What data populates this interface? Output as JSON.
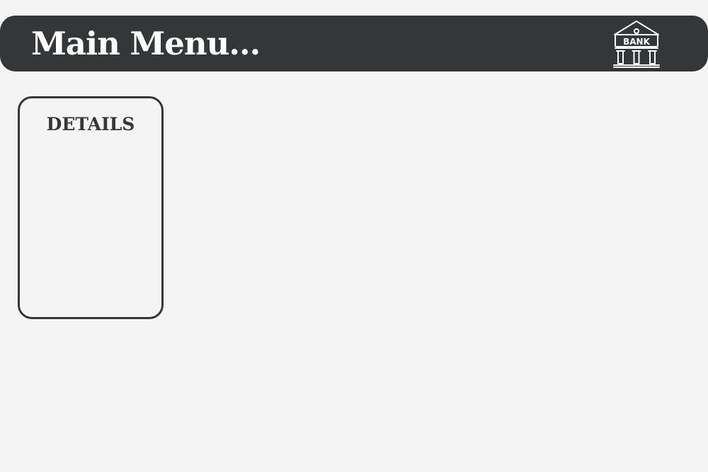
{
  "header": {
    "title": "Main Menu...",
    "icon": "bank-building-icon",
    "icon_text": "BANK",
    "background_color": "#353638",
    "text_color": "#ffffff"
  },
  "details_panel": {
    "title": "DETAILS",
    "border_color": "#353638"
  },
  "page": {
    "background_color": "#f4f4f4"
  }
}
